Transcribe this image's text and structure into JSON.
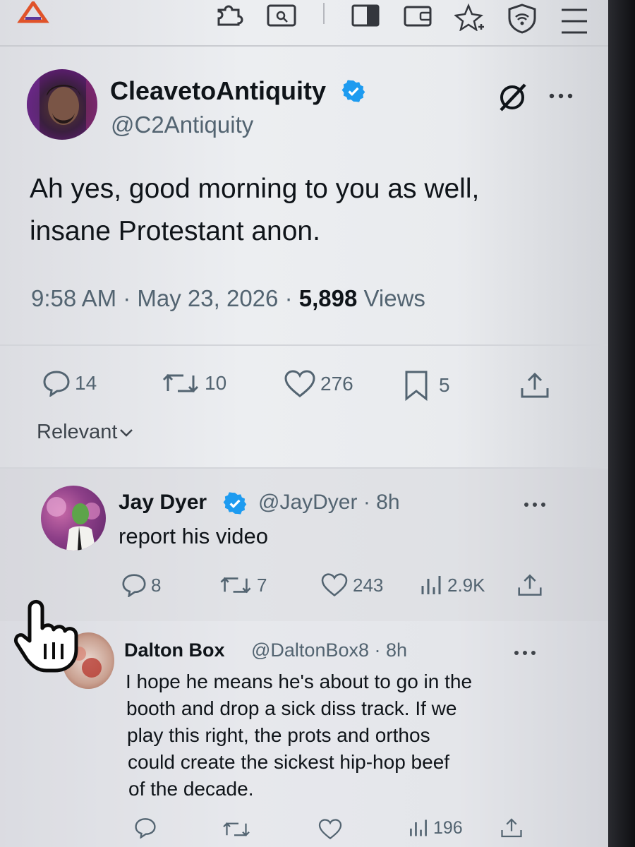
{
  "toolbar": {
    "icons": [
      "brave-logo-icon",
      "extensions-icon",
      "search-tab-icon",
      "sidebar-icon",
      "wallet-icon",
      "leo-ai-icon",
      "vpn-shield-icon",
      "menu-icon"
    ]
  },
  "tweet": {
    "display_name": "CleavetoAntiquity",
    "handle": "@C2Antiquity",
    "text_line1": "Ah yes, good morning to you as well,",
    "text_line2": "insane Protestant anon.",
    "time": "9:58 AM",
    "dot1": "·",
    "date": "May 23, 2026",
    "dot2": "·",
    "views_count": "5,898",
    "views_label": "Views",
    "replies": "14",
    "reposts": "10",
    "likes": "276",
    "bookmarks": "5"
  },
  "sort": {
    "label": "Relevant"
  },
  "replies": [
    {
      "display_name": "Jay Dyer",
      "handle_time": "@JayDyer · 8h",
      "text": "report his video",
      "replies": "8",
      "reposts": "7",
      "likes": "243",
      "views": "2.9K"
    },
    {
      "display_name": "Dalton Box",
      "handle_time": "@DaltonBox8 · 8h",
      "text_lines": [
        "I hope he means he's about to go in the",
        "booth and drop a sick diss track. If we",
        "play this right, the prots and orthos",
        "could create the sickest hip-hop beef",
        "of the decade."
      ],
      "views": "196"
    }
  ],
  "colors": {
    "verified": "#1d9bf0",
    "text": "#0f1419",
    "secondary": "#536471"
  }
}
